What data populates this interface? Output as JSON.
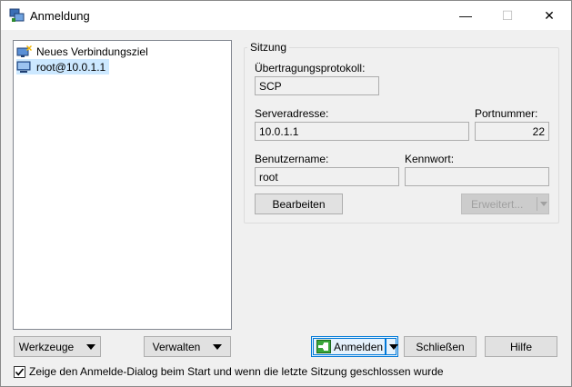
{
  "window": {
    "title": "Anmeldung",
    "icon": "winscp-icon",
    "controls": {
      "minimize": "—",
      "maximize": "☐",
      "close": "✕"
    }
  },
  "sites": {
    "items": [
      {
        "label": "Neues Verbindungsziel",
        "icon": "new-site-icon",
        "selected": false
      },
      {
        "label": "root@10.0.1.1",
        "icon": "computer-icon",
        "selected": true
      }
    ]
  },
  "session": {
    "group_label": "Sitzung",
    "protocol_label": "Übertragungsprotokoll:",
    "protocol_value": "SCP",
    "host_label": "Serveradresse:",
    "host_value": "10.0.1.1",
    "port_label": "Portnummer:",
    "port_value": "22",
    "user_label": "Benutzername:",
    "user_value": "root",
    "password_label": "Kennwort:",
    "password_value": "",
    "edit_button": "Bearbeiten",
    "advanced_button": "Erweitert..."
  },
  "footer": {
    "tools_button": "Werkzeuge",
    "manage_button": "Verwalten",
    "login_button": "Anmelden",
    "close_button": "Schließen",
    "help_button": "Hilfe",
    "show_on_startup_label": "Zeige den Anmelde-Dialog beim Start und wenn die letzte Sitzung geschlossen wurde",
    "show_on_startup_checked": true
  },
  "colors": {
    "accent": "#0078d7",
    "selection": "#cce8ff"
  }
}
